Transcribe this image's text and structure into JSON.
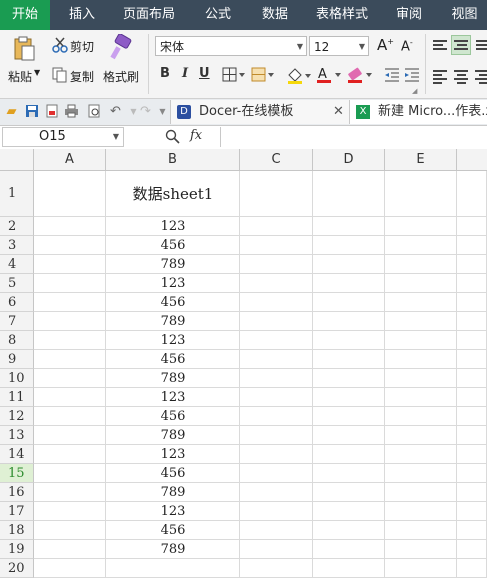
{
  "ribbon_tabs": [
    "开始",
    "插入",
    "页面布局",
    "公式",
    "数据",
    "表格样式",
    "审阅",
    "视图"
  ],
  "clipboard": {
    "paste": "粘贴",
    "cut": "剪切",
    "copy": "复制",
    "format_painter": "格式刷"
  },
  "font": {
    "name": "宋体",
    "size": "12"
  },
  "format_buttons": {
    "bold": "B",
    "italic": "I",
    "underline": "U"
  },
  "doc_tabs": {
    "docer": "Docer-在线模板",
    "new_file": "新建 Micro...作表.xlsx"
  },
  "formula_bar": {
    "cell_ref": "O15",
    "fx": "fx"
  },
  "columns": [
    "A",
    "B",
    "C",
    "D",
    "E"
  ],
  "rows": [
    {
      "n": "1",
      "b": "数据sheet1"
    },
    {
      "n": "2",
      "b": "123"
    },
    {
      "n": "3",
      "b": "456"
    },
    {
      "n": "4",
      "b": "789"
    },
    {
      "n": "5",
      "b": "123"
    },
    {
      "n": "6",
      "b": "456"
    },
    {
      "n": "7",
      "b": "789"
    },
    {
      "n": "8",
      "b": "123"
    },
    {
      "n": "9",
      "b": "456"
    },
    {
      "n": "10",
      "b": "789"
    },
    {
      "n": "11",
      "b": "123"
    },
    {
      "n": "12",
      "b": "456"
    },
    {
      "n": "13",
      "b": "789"
    },
    {
      "n": "14",
      "b": "123"
    },
    {
      "n": "15",
      "b": "456"
    },
    {
      "n": "16",
      "b": "789"
    },
    {
      "n": "17",
      "b": "123"
    },
    {
      "n": "18",
      "b": "456"
    },
    {
      "n": "19",
      "b": "789"
    },
    {
      "n": "20",
      "b": ""
    }
  ],
  "selected_row": "15",
  "colors": {
    "accent": "#1a9c52",
    "tabbar": "#3b4b5b"
  }
}
